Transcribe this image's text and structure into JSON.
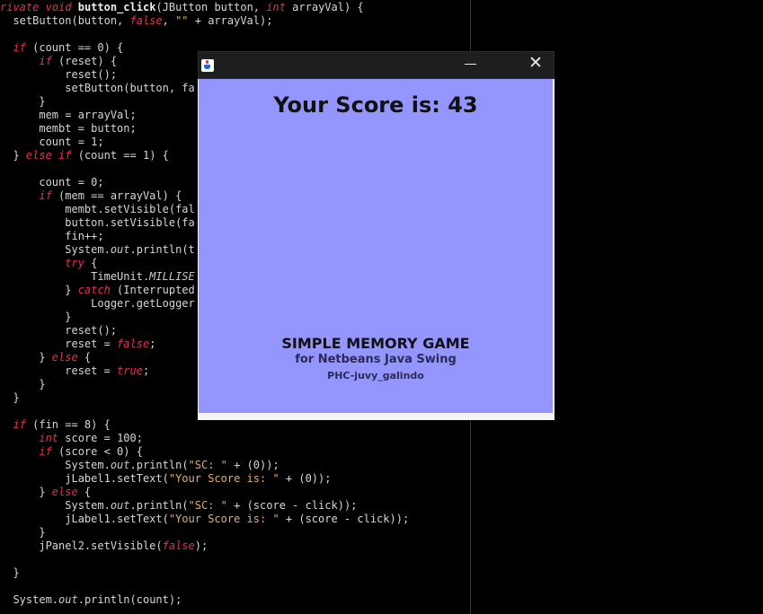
{
  "editor": {
    "lines": [
      "rivate void button_click(JButton button, int arrayVal) {",
      "  setButton(button, false, \"\" + arrayVal);",
      "",
      "  if (count == 0) {",
      "      if (reset) {",
      "          reset();",
      "          setButton(button, fa",
      "      }",
      "      mem = arrayVal;",
      "      membt = button;",
      "      count = 1;",
      "  } else if (count == 1) {",
      "",
      "      count = 0;",
      "      if (mem == arrayVal) {",
      "          membt.setVisible(fal",
      "          button.setVisible(fa",
      "          fin++;",
      "          System.out.println(t",
      "          try {",
      "              TimeUnit.MILLISE",
      "          } catch (Interrupted",
      "              Logger.getLogger",
      "          }",
      "          reset();",
      "          reset = false;",
      "      } else {",
      "          reset = true;",
      "      }",
      "  }",
      "",
      "  if (fin == 8) {",
      "      int score = 100;",
      "      if (score < 0) {",
      "          System.out.println(\"SC: \" + (0));",
      "          jLabel1.setText(\"Your Score is: \" + (0));",
      "      } else {",
      "          System.out.println(\"SC: \" + (score - click));",
      "          jLabel1.setText(\"Your Score is: \" + (score - click));",
      "      }",
      "      jPanel2.setVisible(false);",
      "",
      "  }",
      "",
      "  System.out.println(count);"
    ]
  },
  "window": {
    "icon": "java-icon",
    "minimize_symbol": "—",
    "close_symbol": "✕",
    "score_text": "Your Score is: 43",
    "game_title": "SIMPLE MEMORY GAME",
    "game_subtitle": "for Netbeans Java Swing",
    "game_author": "PHC-juvy_galindo",
    "panel_color": "#9595fe"
  }
}
